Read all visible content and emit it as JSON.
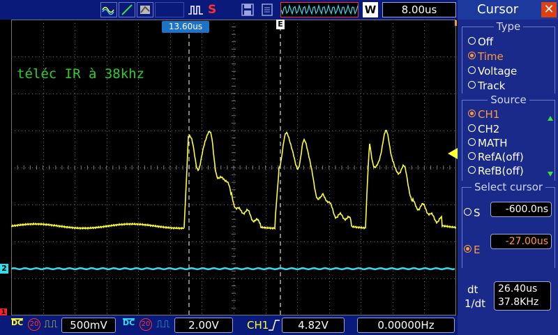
{
  "toolbar": {
    "timebase": "8.00us",
    "stop_label": "S",
    "w_label": "W"
  },
  "annotation": "téléc IR à 38khz",
  "cursors": {
    "s_position_label": "13.60us",
    "e_marker": "E"
  },
  "channel_markers": {
    "ch1": "1",
    "ch2": "2"
  },
  "panel": {
    "title": "Cursor",
    "type_section": {
      "title": "Type",
      "options": [
        "Off",
        "Time",
        "Voltage",
        "Track"
      ],
      "selected": "Time"
    },
    "source_section": {
      "title": "Source",
      "options": [
        "CH1",
        "CH2",
        "MATH",
        "RefA(off)",
        "RefB(off)"
      ],
      "selected": "CH1"
    },
    "select_section": {
      "title": "Select cursor",
      "s_label": "S",
      "s_value": "-600.0ns",
      "e_label": "E",
      "e_value": "-27.00us"
    },
    "measure": {
      "dt_label": "dt",
      "dt_value": "26.40us",
      "inv_dt_label": "1/dt",
      "inv_dt_value": "37.8KHz"
    }
  },
  "status": {
    "ch1_coupling": "DC",
    "ch1_bw": "20",
    "ch1_scale": "500mV",
    "ch2_coupling": "DC",
    "ch2_bw": "20",
    "ch2_scale": "2.00V",
    "trigger_source": "CH1",
    "trigger_level": "4.82V",
    "frequency": "0.00000Hz"
  },
  "colors": {
    "ch1": "#ffff33",
    "ch2": "#33ddee",
    "accent": "#ff9a3a",
    "cursor_label": "#1e73c8"
  }
}
